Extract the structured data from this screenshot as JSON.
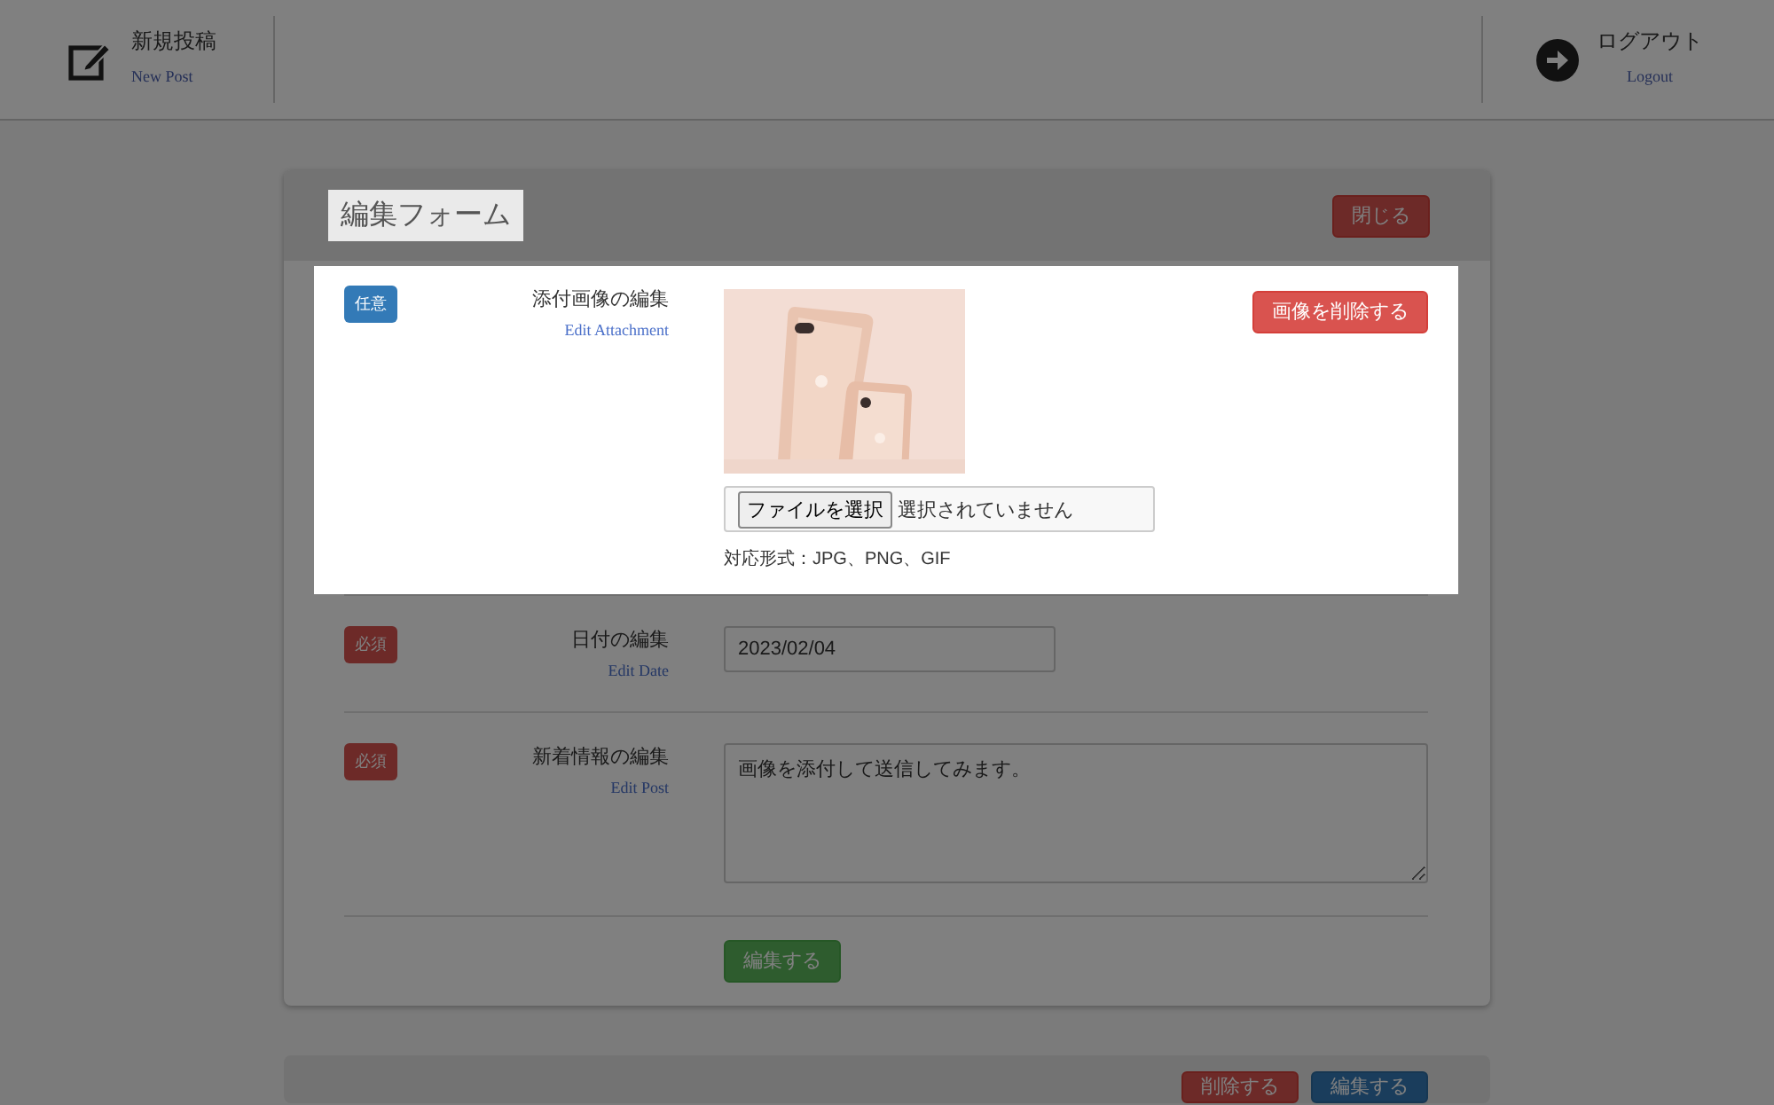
{
  "header": {
    "new_post": {
      "label": "新規投稿",
      "sublabel": "New Post"
    },
    "logout": {
      "label": "ログアウト",
      "sublabel": "Logout"
    }
  },
  "edit_form": {
    "title": {
      "text": "編集フォーム",
      "highlighted": true
    },
    "close_button": "閉じる",
    "fields": [
      {
        "highlighted": true,
        "badge": {
          "text": "任意",
          "kind": "optional"
        },
        "label": "添付画像の編集",
        "sublabel": "Edit Attachment",
        "file_button": "ファイルを選択",
        "file_status": "選択されていません",
        "hint": "対応形式：JPG、PNG、GIF",
        "delete_button": "画像を削除する"
      },
      {
        "kind": "date",
        "highlighted": false,
        "badge": {
          "text": "必須",
          "kind": "required"
        },
        "label": "日付の編集",
        "sublabel": "Edit Date",
        "value": "2023/02/04"
      },
      {
        "kind": "textarea",
        "highlighted": false,
        "badge": {
          "text": "必須",
          "kind": "required"
        },
        "label": "新着情報の編集",
        "sublabel": "Edit Post",
        "value": "画像を添付して送信してみます。"
      }
    ],
    "submit_button": "編集する"
  },
  "next_panel": {
    "buttons": [
      {
        "text": "削除する",
        "kind": "danger"
      },
      {
        "text": "編集する",
        "kind": "primary"
      }
    ]
  }
}
